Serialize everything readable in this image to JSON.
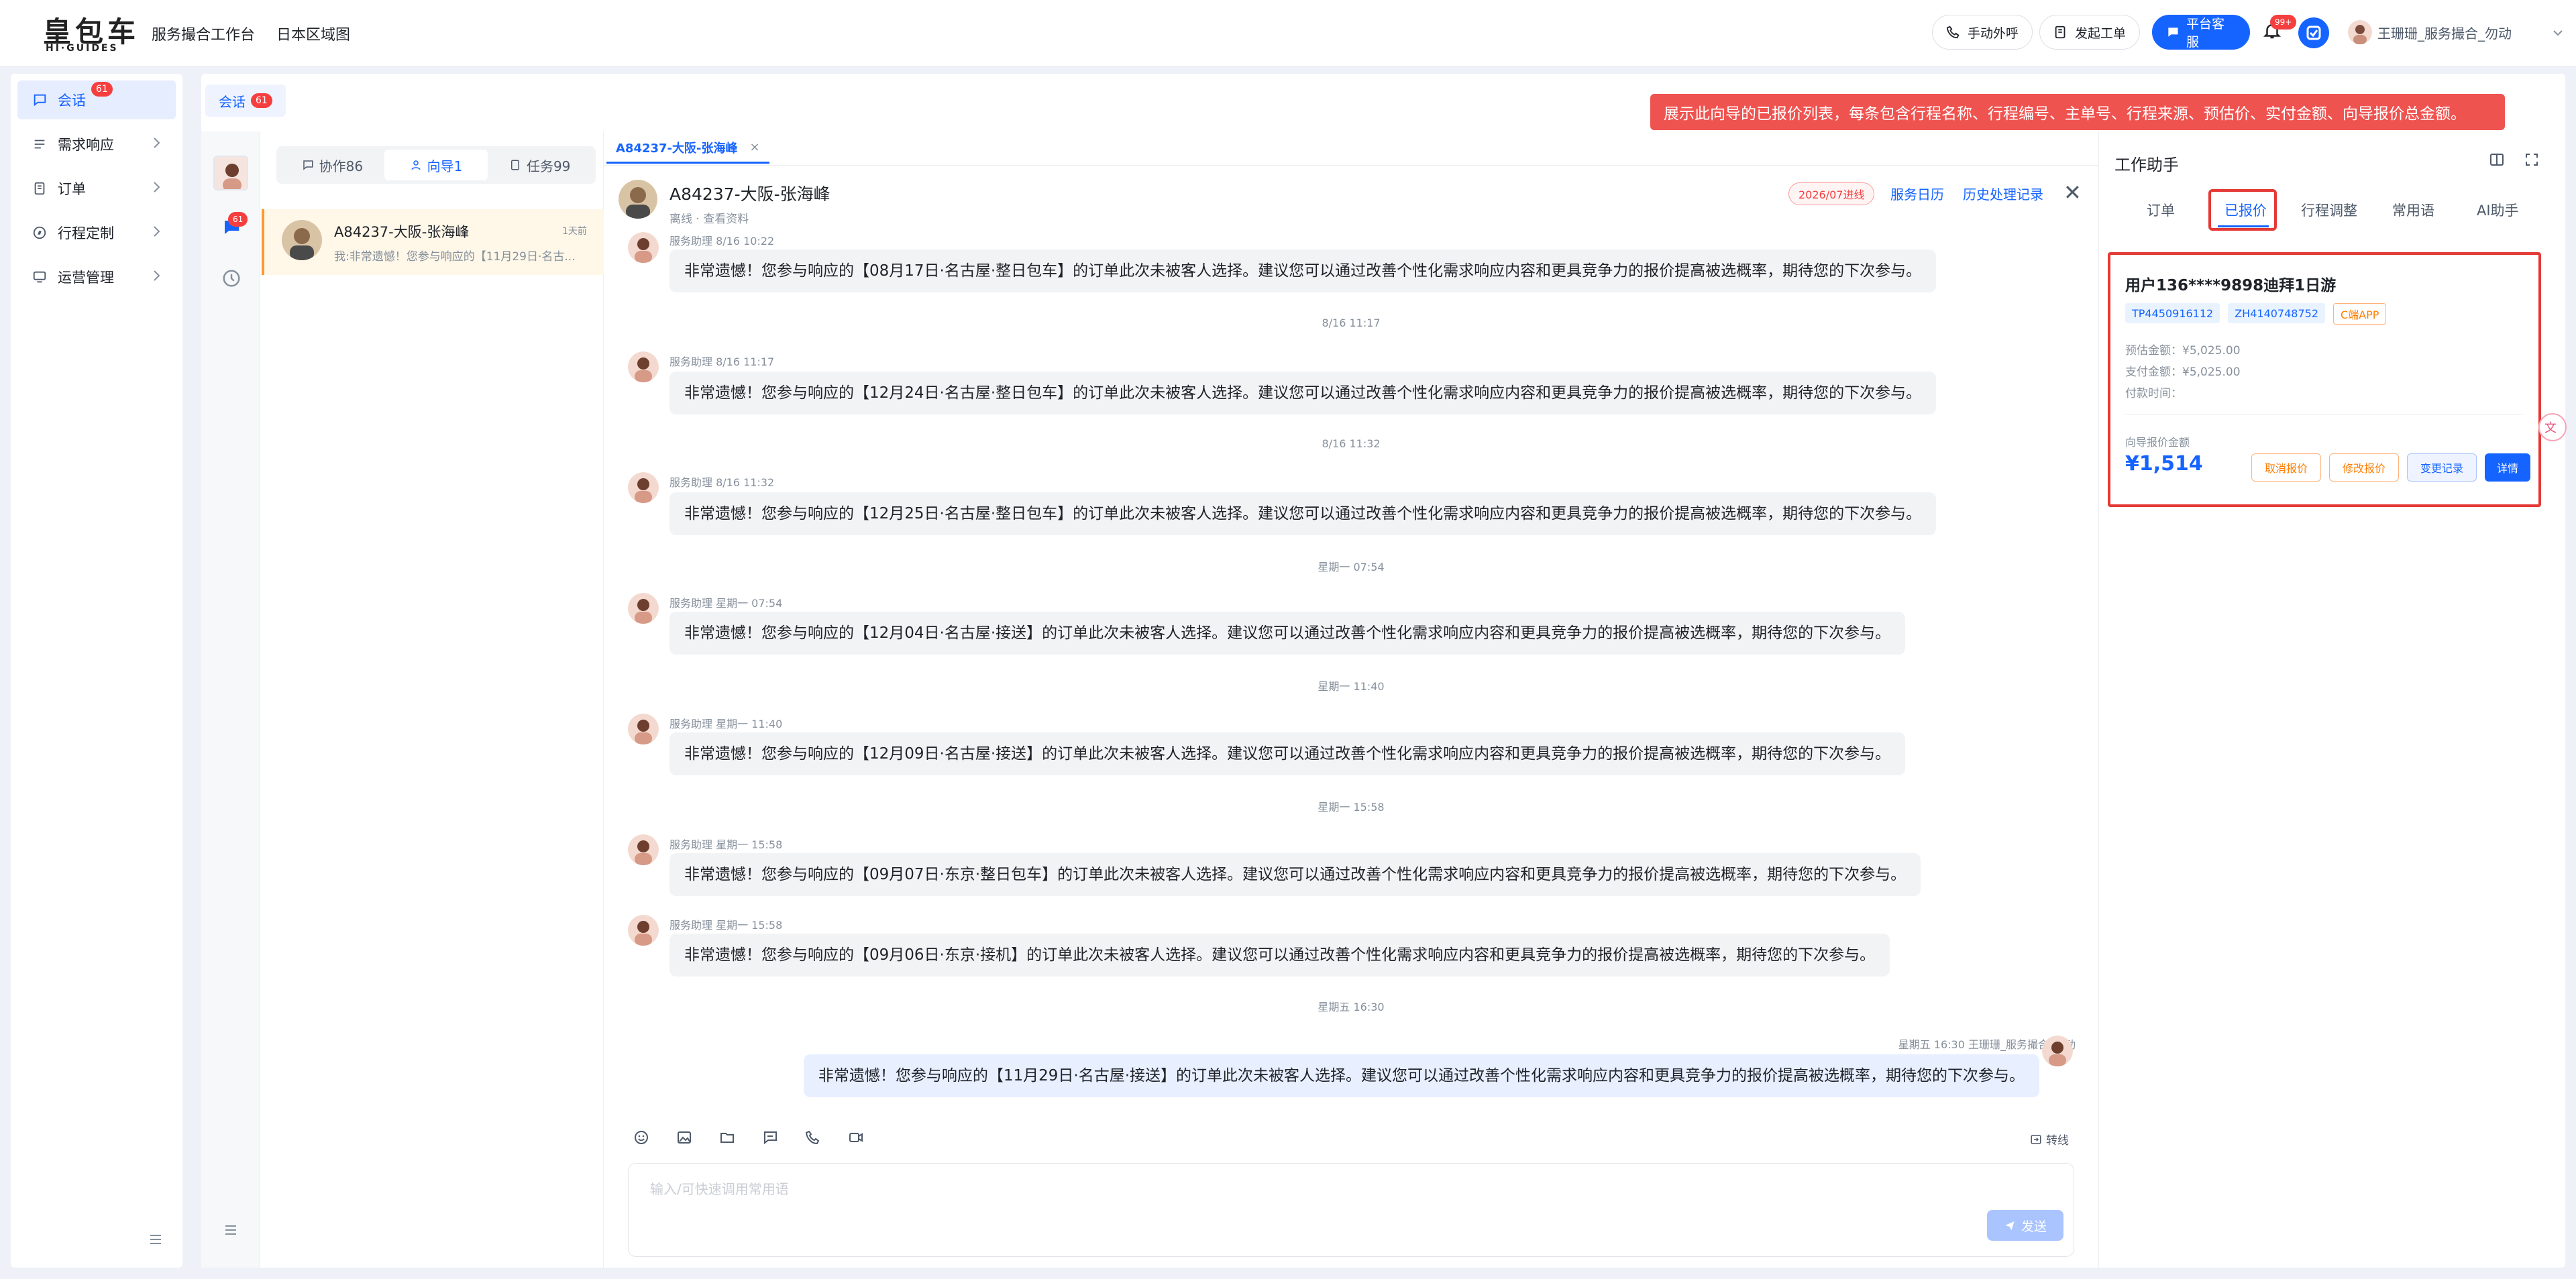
{
  "brand": {
    "name_cn": "皇包车",
    "name_en": "HI·GUIDES"
  },
  "topnav": {
    "item1": "服务撮合工作台",
    "item2": "日本区域图"
  },
  "header_actions": {
    "call": "手动外呼",
    "ticket": "发起工单",
    "service": "平台客服",
    "notif_badge": "99+",
    "user": "王珊珊_服务撮合_勿动"
  },
  "sidebar": {
    "items": [
      {
        "label": "会话",
        "badge": "61"
      },
      {
        "label": "需求响应"
      },
      {
        "label": "订单"
      },
      {
        "label": "行程定制"
      },
      {
        "label": "运营管理"
      }
    ]
  },
  "main_tab": {
    "label": "会话",
    "badge": "61"
  },
  "tooltip": "展示此向导的已报价列表，每条包含行程名称、行程编号、主单号、行程来源、预估价、实付金额、向导报价总金额。",
  "rail": {
    "badge": "61"
  },
  "filter_tabs": [
    {
      "label": "协作86"
    },
    {
      "label": "向导1"
    },
    {
      "label": "任务99"
    }
  ],
  "conversation": {
    "name": "A84237-大阪-张海峰",
    "time": "1天前",
    "preview": "我:非常遗憾！您参与响应的【11月29日·名古..."
  },
  "chat": {
    "tab_label": "A84237-大阪-张海峰",
    "title": "A84237-大阪-张海峰",
    "status": "离线 · 查看资料",
    "progress_tag": "2026/07进线",
    "link_calendar": "服务日历",
    "link_history": "历史处理记录",
    "messages": [
      {
        "meta": "服务助理 8/16 10:22",
        "text": "非常遗憾！您参与响应的【08月17日·名古屋·整日包车】的订单此次未被客人选择。建议您可以通过改善个性化需求响应内容和更具竞争力的报价提高被选概率，期待您的下次参与。"
      },
      {
        "sep": "8/16 11:17"
      },
      {
        "meta": "服务助理 8/16 11:17",
        "text": "非常遗憾！您参与响应的【12月24日·名古屋·整日包车】的订单此次未被客人选择。建议您可以通过改善个性化需求响应内容和更具竞争力的报价提高被选概率，期待您的下次参与。"
      },
      {
        "sep": "8/16 11:32"
      },
      {
        "meta": "服务助理 8/16 11:32",
        "text": "非常遗憾！您参与响应的【12月25日·名古屋·整日包车】的订单此次未被客人选择。建议您可以通过改善个性化需求响应内容和更具竞争力的报价提高被选概率，期待您的下次参与。"
      },
      {
        "sep": "星期一 07:54"
      },
      {
        "meta": "服务助理 星期一 07:54",
        "text": "非常遗憾！您参与响应的【12月04日·名古屋·接送】的订单此次未被客人选择。建议您可以通过改善个性化需求响应内容和更具竞争力的报价提高被选概率，期待您的下次参与。"
      },
      {
        "sep": "星期一 11:40"
      },
      {
        "meta": "服务助理 星期一 11:40",
        "text": "非常遗憾！您参与响应的【12月09日·名古屋·接送】的订单此次未被客人选择。建议您可以通过改善个性化需求响应内容和更具竞争力的报价提高被选概率，期待您的下次参与。"
      },
      {
        "sep": "星期一 15:58"
      },
      {
        "meta": "服务助理 星期一 15:58",
        "text": "非常遗憾！您参与响应的【09月07日·东京·整日包车】的订单此次未被客人选择。建议您可以通过改善个性化需求响应内容和更具竞争力的报价提高被选概率，期待您的下次参与。"
      },
      {
        "meta": "服务助理 星期一 15:58",
        "text": "非常遗憾！您参与响应的【09月06日·东京·接机】的订单此次未被客人选择。建议您可以通过改善个性化需求响应内容和更具竞争力的报价提高被选概率，期待您的下次参与。"
      },
      {
        "sep": "星期五 16:30"
      },
      {
        "meta": "星期五 16:30 王珊珊_服务撮合_勿动",
        "text": "非常遗憾！您参与响应的【11月29日·名古屋·接送】的订单此次未被客人选择。建议您可以通过改善个性化需求响应内容和更具竞争力的报价提高被选概率，期待您的下次参与。"
      }
    ],
    "transfer": "转线",
    "input_placeholder": "输入/可快速调用常用语",
    "send": "发送"
  },
  "assistant": {
    "title": "工作助手",
    "tabs": [
      "订单",
      "已报价",
      "行程调整",
      "常用语",
      "AI助手"
    ],
    "card": {
      "title": "用户136****9898迪拜1日游",
      "tags": [
        "TP4450916112",
        "ZH4140748752",
        "C端APP"
      ],
      "est_label": "预估金额：",
      "est_value": "¥5,025.00",
      "paid_label": "支付金额：",
      "paid_value": "¥5,025.00",
      "paytime_label": "付款时间：",
      "quote_label": "向导报价金额",
      "quote_value": "¥1,514",
      "btn_cancel": "取消报价",
      "btn_modify": "修改报价",
      "btn_log": "变更记录",
      "btn_detail": "详情"
    }
  },
  "colors": {
    "accent": "#1664ff",
    "alert": "#e53935",
    "orange": "#ff7d00"
  }
}
